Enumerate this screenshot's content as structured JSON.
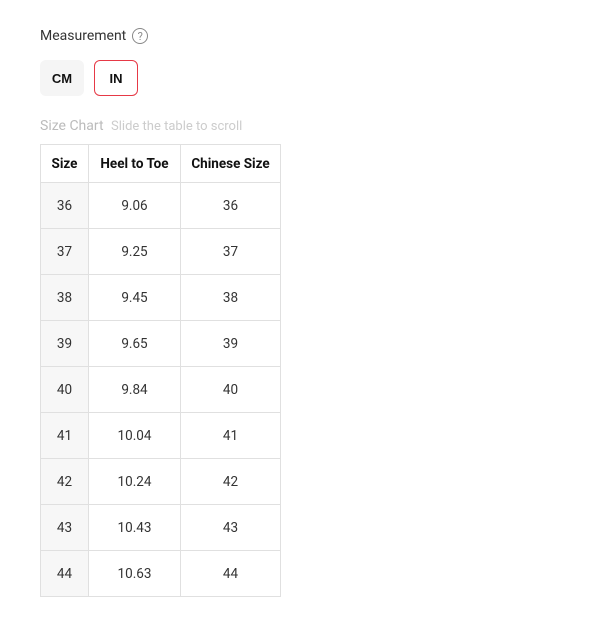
{
  "measurement": {
    "label": "Measurement"
  },
  "units": {
    "cm_label": "CM",
    "in_label": "IN"
  },
  "size_chart": {
    "label": "Size Chart",
    "hint": "Slide the table to scroll",
    "headers": [
      "Size",
      "Heel to Toe",
      "Chinese Size"
    ],
    "rows": [
      {
        "size": "36",
        "heel_to_toe": "9.06",
        "chinese_size": "36"
      },
      {
        "size": "37",
        "heel_to_toe": "9.25",
        "chinese_size": "37"
      },
      {
        "size": "38",
        "heel_to_toe": "9.45",
        "chinese_size": "38"
      },
      {
        "size": "39",
        "heel_to_toe": "9.65",
        "chinese_size": "39"
      },
      {
        "size": "40",
        "heel_to_toe": "9.84",
        "chinese_size": "40"
      },
      {
        "size": "41",
        "heel_to_toe": "10.04",
        "chinese_size": "41"
      },
      {
        "size": "42",
        "heel_to_toe": "10.24",
        "chinese_size": "42"
      },
      {
        "size": "43",
        "heel_to_toe": "10.43",
        "chinese_size": "43"
      },
      {
        "size": "44",
        "heel_to_toe": "10.63",
        "chinese_size": "44"
      }
    ]
  }
}
